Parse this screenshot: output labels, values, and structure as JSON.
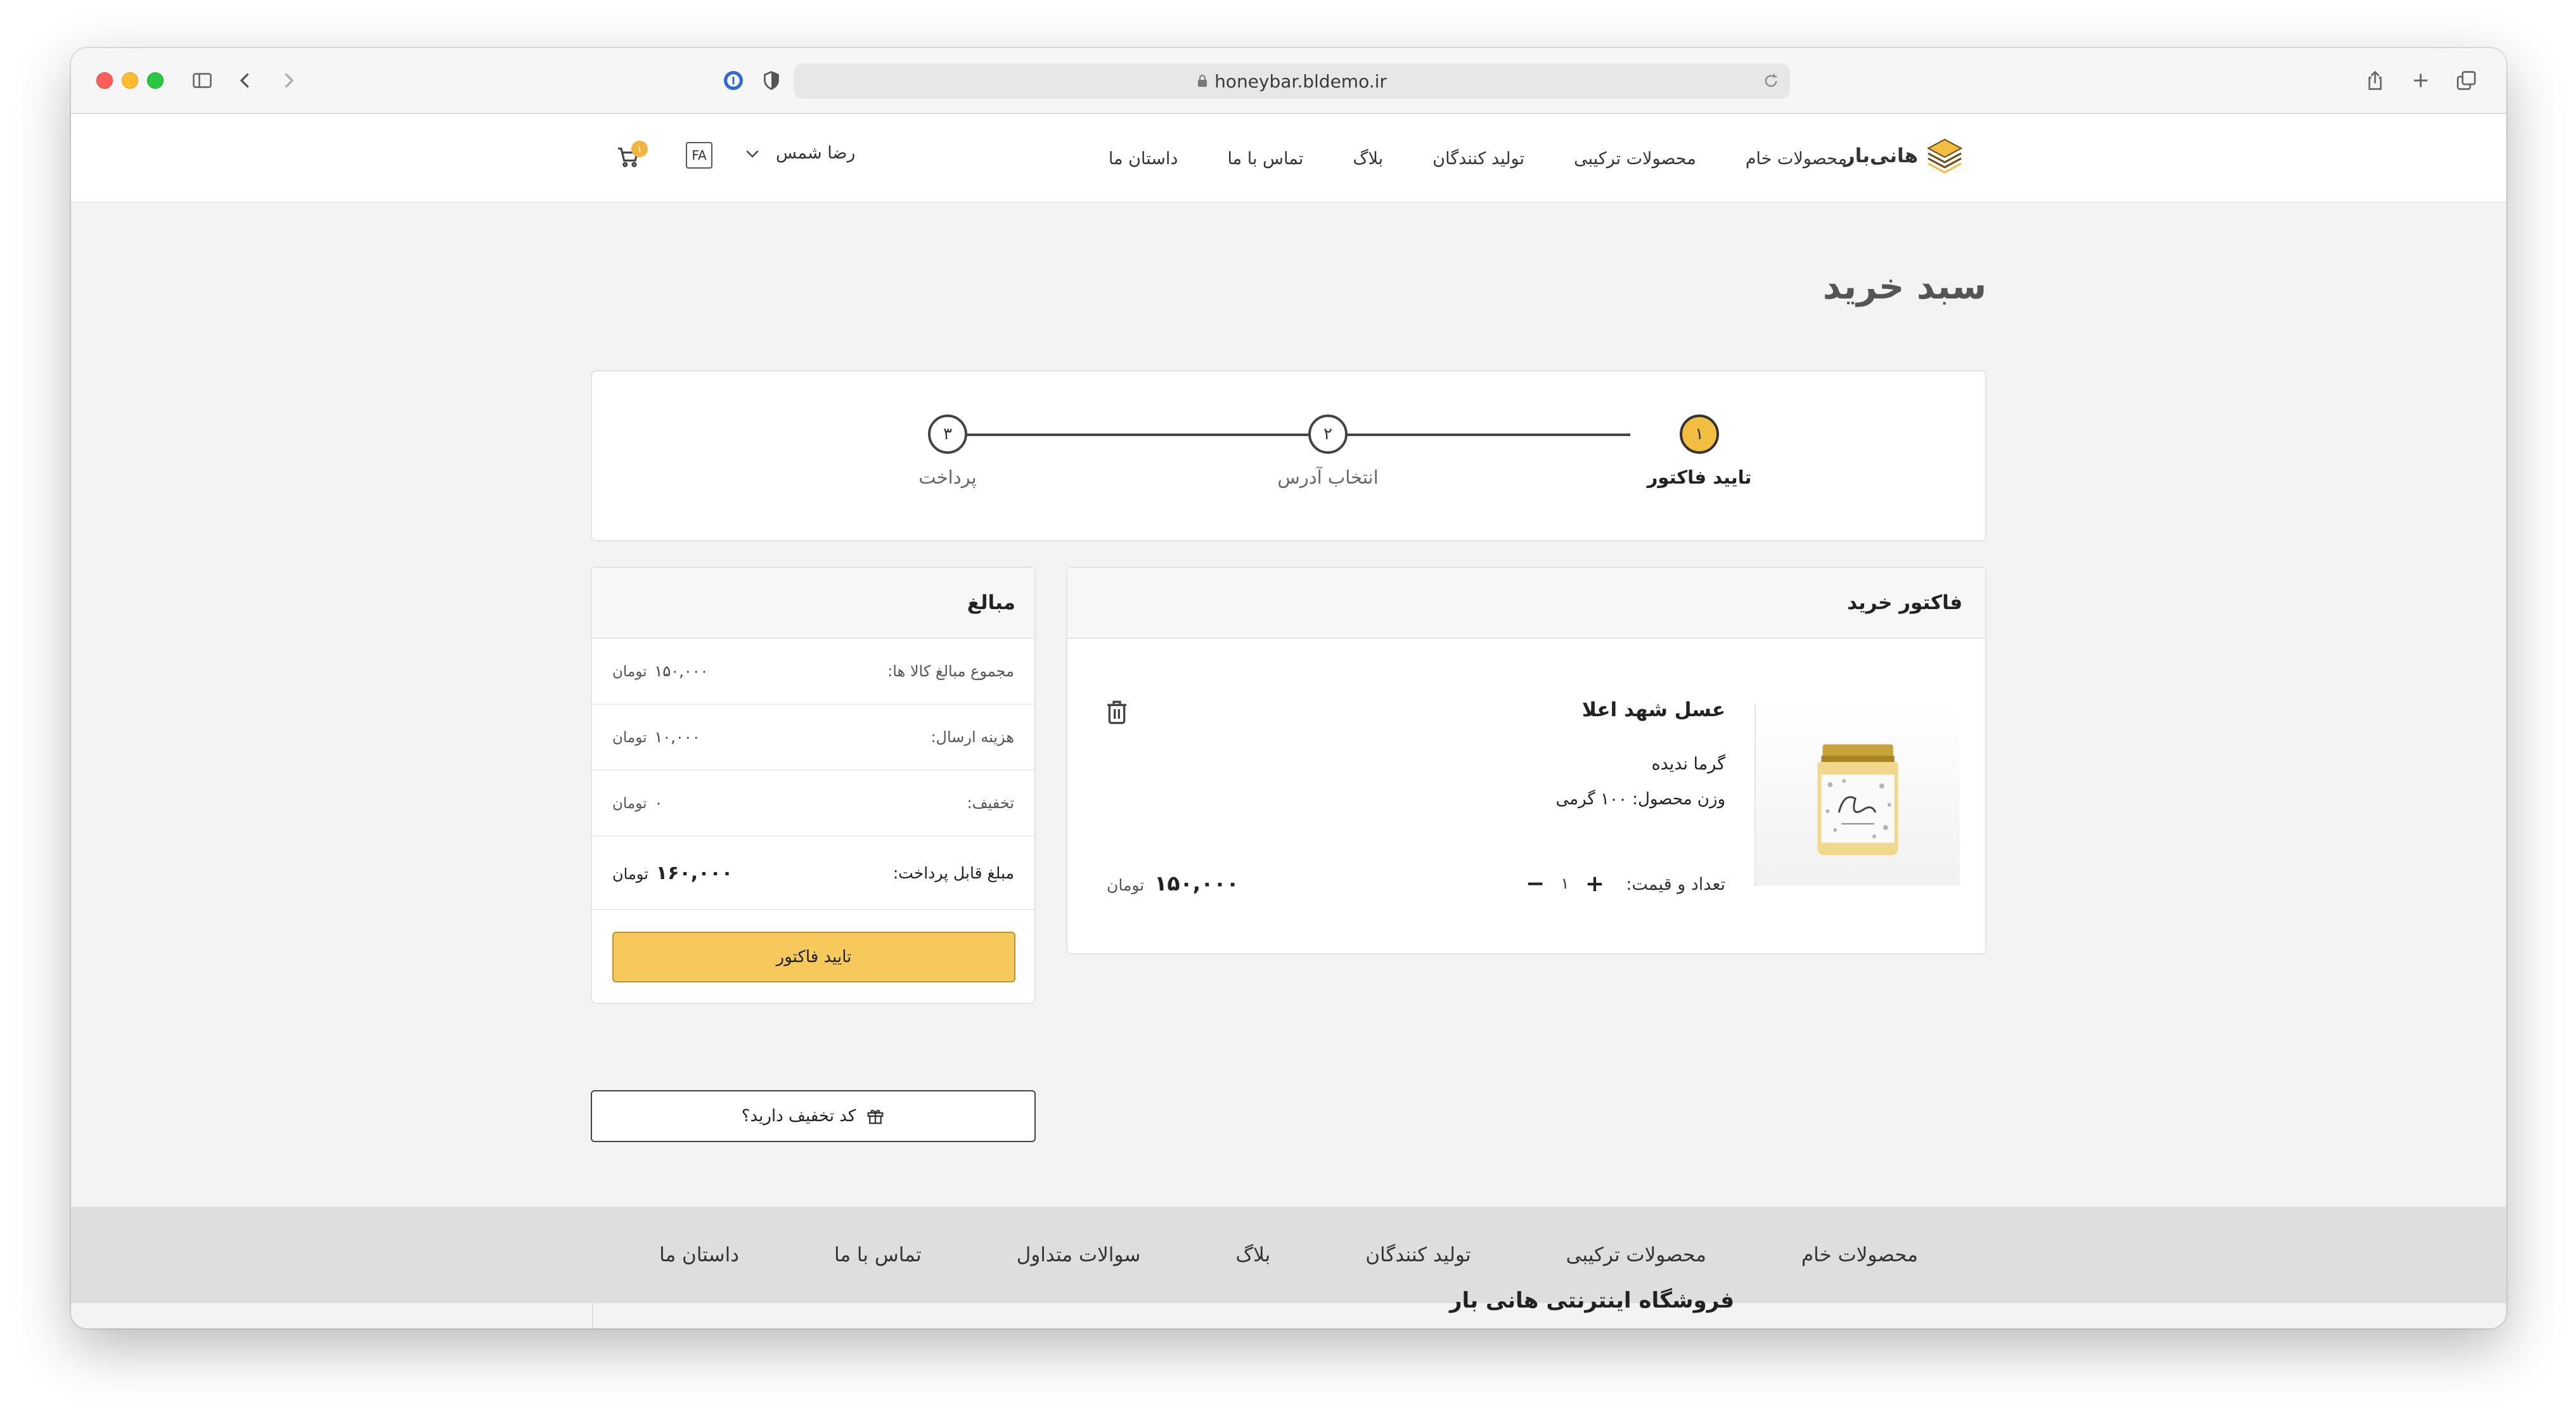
{
  "browser": {
    "url": "honeybar.bldemo.ir",
    "icons": [
      "sidebar-icon",
      "back-icon",
      "forward-icon",
      "password-icon",
      "shield-icon",
      "share-icon",
      "new-tab-icon",
      "tabs-icon"
    ]
  },
  "header": {
    "brand": "هانی‌بار",
    "nav": [
      "محصولات خام",
      "محصولات ترکیبی",
      "تولید کنندگان",
      "بلاگ",
      "تماس با ما",
      "داستان ما"
    ],
    "user_name": "رضا شمس",
    "lang": "FA",
    "cart_count": "۱"
  },
  "page": {
    "title": "سبد خرید"
  },
  "steps": [
    {
      "number": "۱",
      "label": "تایید فاکتور",
      "active": true
    },
    {
      "number": "۲",
      "label": "انتخاب آدرس",
      "active": false
    },
    {
      "number": "۳",
      "label": "پرداخت",
      "active": false
    }
  ],
  "invoice": {
    "title": "فاکتور خرید",
    "item": {
      "name": "عسل شهد اعلا",
      "attribute": "گرما ندیده",
      "weight": "وزن محصول: ۱۰۰ گرمی",
      "qty_label": "تعداد و قیمت:",
      "qty": "۱",
      "price": "۱۵۰,۰۰۰",
      "currency": "تومان"
    }
  },
  "totals": {
    "title": "مبالغ",
    "rows": [
      {
        "label": "مجموع مبالغ کالا ها:",
        "value": "۱۵۰,۰۰۰",
        "currency": "تومان"
      },
      {
        "label": "هزینه ارسال:",
        "value": "۱۰,۰۰۰",
        "currency": "تومان"
      },
      {
        "label": "تخفیف:",
        "value": "۰",
        "currency": "تومان"
      }
    ],
    "payable_label": "مبلغ قابل پرداخت:",
    "payable_value": "۱۶۰,۰۰۰",
    "payable_currency": "تومان",
    "confirm_label": "تایید فاکتور"
  },
  "coupon": {
    "label": "کد تخفیف دارید؟"
  },
  "footer": {
    "nav": [
      "محصولات خام",
      "محصولات ترکیبی",
      "تولید کنندگان",
      "بلاگ",
      "سوالات متداول",
      "تماس با ما",
      "داستان ما"
    ],
    "store_title": "فروشگاه اینترنتی هانی بار"
  },
  "colors": {
    "accent": "#f2be40",
    "button": "#f5c95b"
  }
}
